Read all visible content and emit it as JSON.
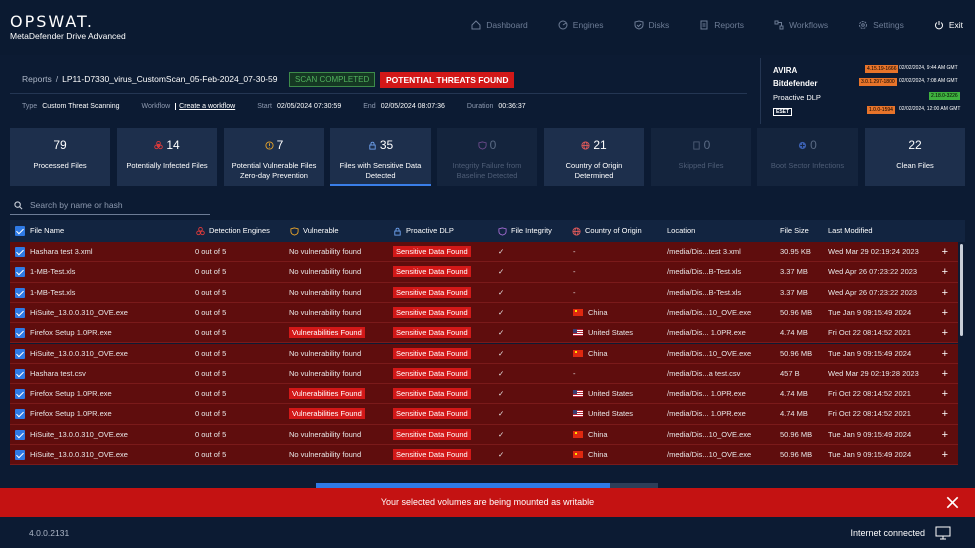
{
  "header": {
    "logo": "OPSWAT.",
    "product": "MetaDefender Drive Advanced",
    "nav": [
      {
        "label": "Dashboard",
        "icon": "home-icon"
      },
      {
        "label": "Engines",
        "icon": "engines-icon"
      },
      {
        "label": "Disks",
        "icon": "shield-check-icon"
      },
      {
        "label": "Reports",
        "icon": "document-icon"
      },
      {
        "label": "Workflows",
        "icon": "workflow-icon"
      },
      {
        "label": "Settings",
        "icon": "gear-icon"
      },
      {
        "label": "Exit",
        "icon": "power-icon"
      }
    ]
  },
  "scan": {
    "breadcrumb_root": "Reports",
    "breadcrumb_sep": "/",
    "name": "LP11-D7330_virus_CustomScan_05-Feb-2024_07-30-59",
    "status": "SCAN COMPLETED",
    "verdict": "POTENTIAL THREATS FOUND",
    "type_label": "Type",
    "type": "Custom Threat Scanning",
    "workflow_label": "Workflow",
    "workflow": "Create a workflow",
    "start_label": "Start",
    "start": "02/05/2024 07:30:59",
    "end_label": "End",
    "end": "02/05/2024 08:07:36",
    "duration_label": "Duration",
    "duration": "00:36:37"
  },
  "engines": [
    {
      "name": "AVIRA",
      "version": "4.15.19-1666",
      "date": "02/02/2024, 9:44 AM GMT",
      "ver_color": "#e8742a"
    },
    {
      "name": "Bitdefender",
      "version": "3.0.1.297-1800",
      "date": "02/02/2024, 7:08 AM GMT",
      "ver_color": "#e8742a"
    },
    {
      "name": "Proactive DLP",
      "version": "2.18.0-3226",
      "date": "02/02/2024, 9:15 AM GMT",
      "ver_color": "#3fb23f"
    },
    {
      "name": "ESET",
      "version": "1.0.0-1594",
      "date": "02/02/2024, 12:00 AM GMT",
      "ver_color": "#e8742a"
    }
  ],
  "stats": [
    {
      "value": "79",
      "label": "Processed Files",
      "icon": "",
      "dim": false
    },
    {
      "value": "14",
      "label": "Potentially Infected Files",
      "icon": "biohazard-icon",
      "dim": false
    },
    {
      "value": "7",
      "label": "Potential Vulnerable Files Zero-day Prevention",
      "icon": "warning-icon",
      "dim": false
    },
    {
      "value": "35",
      "label": "Files with Sensitive Data Detected",
      "icon": "lock-icon",
      "dim": false,
      "active": true
    },
    {
      "value": "0",
      "label": "Integrity Failure from Baseline Detected",
      "icon": "integrity-icon",
      "dim": true
    },
    {
      "value": "21",
      "label": "Country of Origin Determined",
      "icon": "globe-icon",
      "dim": false
    },
    {
      "value": "0",
      "label": "Skipped Files",
      "icon": "skip-icon",
      "dim": true
    },
    {
      "value": "0",
      "label": "Boot Sector Infections",
      "icon": "boot-icon",
      "dim": true
    },
    {
      "value": "22",
      "label": "Clean Files",
      "icon": "",
      "dim": false
    }
  ],
  "search": {
    "placeholder": "Search by name or hash",
    "value": ""
  },
  "table": {
    "columns": [
      "File Name",
      "Detection Engines",
      "Vulnerable",
      "Proactive DLP",
      "File Integrity",
      "Country of Origin",
      "Location",
      "File Size",
      "Last Modified"
    ],
    "rows": [
      {
        "name": "Hashara test 3.xml",
        "engines": "0 out of 5",
        "vuln": "No vulnerability found",
        "vuln_flag": false,
        "dlp": "Sensitive Data Found",
        "integrity": "✓",
        "country": "-",
        "flag": "",
        "location": "/media/Dis...test 3.xml",
        "size": "30.95 KB",
        "modified": "Wed Mar 29 02:19:24 2023"
      },
      {
        "name": "1-MB-Test.xls",
        "engines": "0 out of 5",
        "vuln": "No vulnerability found",
        "vuln_flag": false,
        "dlp": "Sensitive Data Found",
        "integrity": "✓",
        "country": "-",
        "flag": "",
        "location": "/media/Dis...B-Test.xls",
        "size": "3.37 MB",
        "modified": "Wed Apr 26 07:23:22 2023"
      },
      {
        "name": "1-MB-Test.xls",
        "engines": "0 out of 5",
        "vuln": "No vulnerability found",
        "vuln_flag": false,
        "dlp": "Sensitive Data Found",
        "integrity": "✓",
        "country": "-",
        "flag": "",
        "location": "/media/Dis...B-Test.xls",
        "size": "3.37 MB",
        "modified": "Wed Apr 26 07:23:22 2023"
      },
      {
        "name": "HiSuite_13.0.0.310_OVE.exe",
        "engines": "0 out of 5",
        "vuln": "No vulnerability found",
        "vuln_flag": false,
        "dlp": "Sensitive Data Found",
        "integrity": "✓",
        "country": "China",
        "flag": "cn",
        "location": "/media/Dis...10_OVE.exe",
        "size": "50.96 MB",
        "modified": "Tue Jan 9 09:15:49 2024"
      },
      {
        "name": "Firefox Setup 1.0PR.exe",
        "engines": "0 out of 5",
        "vuln": "Vulnerabilities Found",
        "vuln_flag": true,
        "dlp": "Sensitive Data Found",
        "integrity": "✓",
        "country": "United States",
        "flag": "us",
        "location": "/media/Dis... 1.0PR.exe",
        "size": "4.74 MB",
        "modified": "Fri Oct 22 08:14:52 2021"
      },
      {
        "name": "HiSuite_13.0.0.310_OVE.exe",
        "engines": "0 out of 5",
        "vuln": "No vulnerability found",
        "vuln_flag": false,
        "dlp": "Sensitive Data Found",
        "integrity": "✓",
        "country": "China",
        "flag": "cn",
        "location": "/media/Dis...10_OVE.exe",
        "size": "50.96 MB",
        "modified": "Tue Jan 9 09:15:49 2024"
      },
      {
        "name": "Hashara test.csv",
        "engines": "0 out of 5",
        "vuln": "No vulnerability found",
        "vuln_flag": false,
        "dlp": "Sensitive Data Found",
        "integrity": "✓",
        "country": "-",
        "flag": "",
        "location": "/media/Dis...a test.csv",
        "size": "457 B",
        "modified": "Wed Mar 29 02:19:28 2023"
      },
      {
        "name": "Firefox Setup 1.0PR.exe",
        "engines": "0 out of 5",
        "vuln": "Vulnerabilities Found",
        "vuln_flag": true,
        "dlp": "Sensitive Data Found",
        "integrity": "✓",
        "country": "United States",
        "flag": "us",
        "location": "/media/Dis... 1.0PR.exe",
        "size": "4.74 MB",
        "modified": "Fri Oct 22 08:14:52 2021"
      },
      {
        "name": "Firefox Setup 1.0PR.exe",
        "engines": "0 out of 5",
        "vuln": "Vulnerabilities Found",
        "vuln_flag": true,
        "dlp": "Sensitive Data Found",
        "integrity": "✓",
        "country": "United States",
        "flag": "us",
        "location": "/media/Dis... 1.0PR.exe",
        "size": "4.74 MB",
        "modified": "Fri Oct 22 08:14:52 2021"
      },
      {
        "name": "HiSuite_13.0.0.310_OVE.exe",
        "engines": "0 out of 5",
        "vuln": "No vulnerability found",
        "vuln_flag": false,
        "dlp": "Sensitive Data Found",
        "integrity": "✓",
        "country": "China",
        "flag": "cn",
        "location": "/media/Dis...10_OVE.exe",
        "size": "50.96 MB",
        "modified": "Tue Jan 9 09:15:49 2024"
      },
      {
        "name": "HiSuite_13.0.0.310_OVE.exe",
        "engines": "0 out of 5",
        "vuln": "No vulnerability found",
        "vuln_flag": false,
        "dlp": "Sensitive Data Found",
        "integrity": "✓",
        "country": "China",
        "flag": "cn",
        "location": "/media/Dis...10_OVE.exe",
        "size": "50.96 MB",
        "modified": "Tue Jan 9 09:15:49 2024"
      }
    ],
    "row_action": "+"
  },
  "progress": {
    "fraction": 0.86
  },
  "toast": {
    "message": "Your selected volumes are being mounted as writable"
  },
  "footer": {
    "version": "4.0.0.2131",
    "connection": "Internet connected"
  },
  "colors": {
    "accent": "#2f7ae5",
    "danger": "#d21818",
    "row_bg": "#5f0d0d",
    "success": "#52b35f"
  }
}
